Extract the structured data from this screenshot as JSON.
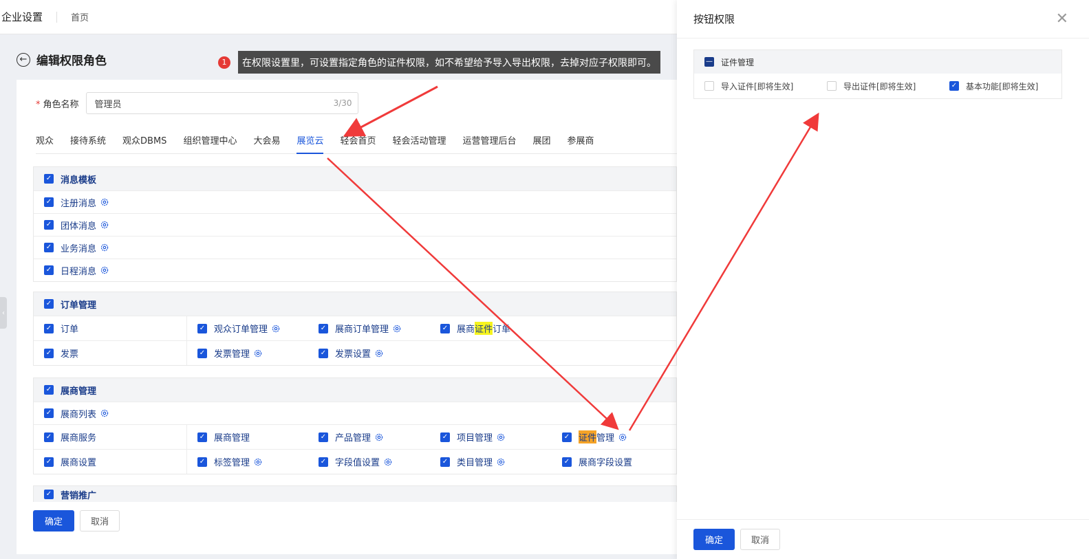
{
  "topbar": {
    "brand": "企业设置",
    "home": "首页"
  },
  "page": {
    "title": "编辑权限角色"
  },
  "tooltip": {
    "badge": "1",
    "text": "在权限设置里，可设置指定角色的证件权限，如不希望给予导入导出权限，去掉对应子权限即可。"
  },
  "role": {
    "required_mark": "*",
    "label": "角色名称",
    "value": "管理员",
    "count": "3/30"
  },
  "tabs": [
    "观众",
    "接待系统",
    "观众DBMS",
    "组织管理中心",
    "大会易",
    "展览云",
    "轻会首页",
    "轻会活动管理",
    "运营管理后台",
    "展团",
    "参展商"
  ],
  "active_tab": "展览云",
  "sections": {
    "msg": {
      "title": "消息模板",
      "rows": [
        "注册消息",
        "团体消息",
        "业务消息",
        "日程消息"
      ]
    },
    "order": {
      "title": "订单管理",
      "rows": [
        {
          "head": "订单",
          "items": [
            "观众订单管理",
            "展商订单管理"
          ],
          "last_pre": "展商",
          "last_hl": "证件",
          "last_post": "订单"
        },
        {
          "head": "发票",
          "items": [
            "发票管理",
            "发票设置"
          ]
        }
      ]
    },
    "exhibitor": {
      "title": "展商管理",
      "list": "展商列表",
      "rows": [
        {
          "head": "展商服务",
          "items": [
            "展商管理",
            "产品管理",
            "项目管理"
          ],
          "last_hl": "证件",
          "last_post": "管理"
        },
        {
          "head": "展商设置",
          "items": [
            "标签管理",
            "字段值设置",
            "类目管理",
            "展商字段设置"
          ]
        }
      ]
    },
    "marketing": {
      "title": "营销推广"
    }
  },
  "footer": {
    "ok": "确定",
    "cancel": "取消"
  },
  "drawer": {
    "title": "按钮权限",
    "group": "证件管理",
    "items": [
      {
        "label": "导入证件[即将生效]",
        "checked": false
      },
      {
        "label": "导出证件[即将生效]",
        "checked": false
      },
      {
        "label": "基本功能[即将生效]",
        "checked": true
      }
    ],
    "ok": "确定",
    "cancel": "取消"
  },
  "colors": {
    "primary": "#1a56db",
    "arrow": "#f03a3a",
    "highlight_yellow": "#f6f41f",
    "highlight_orange": "#f5a327"
  }
}
